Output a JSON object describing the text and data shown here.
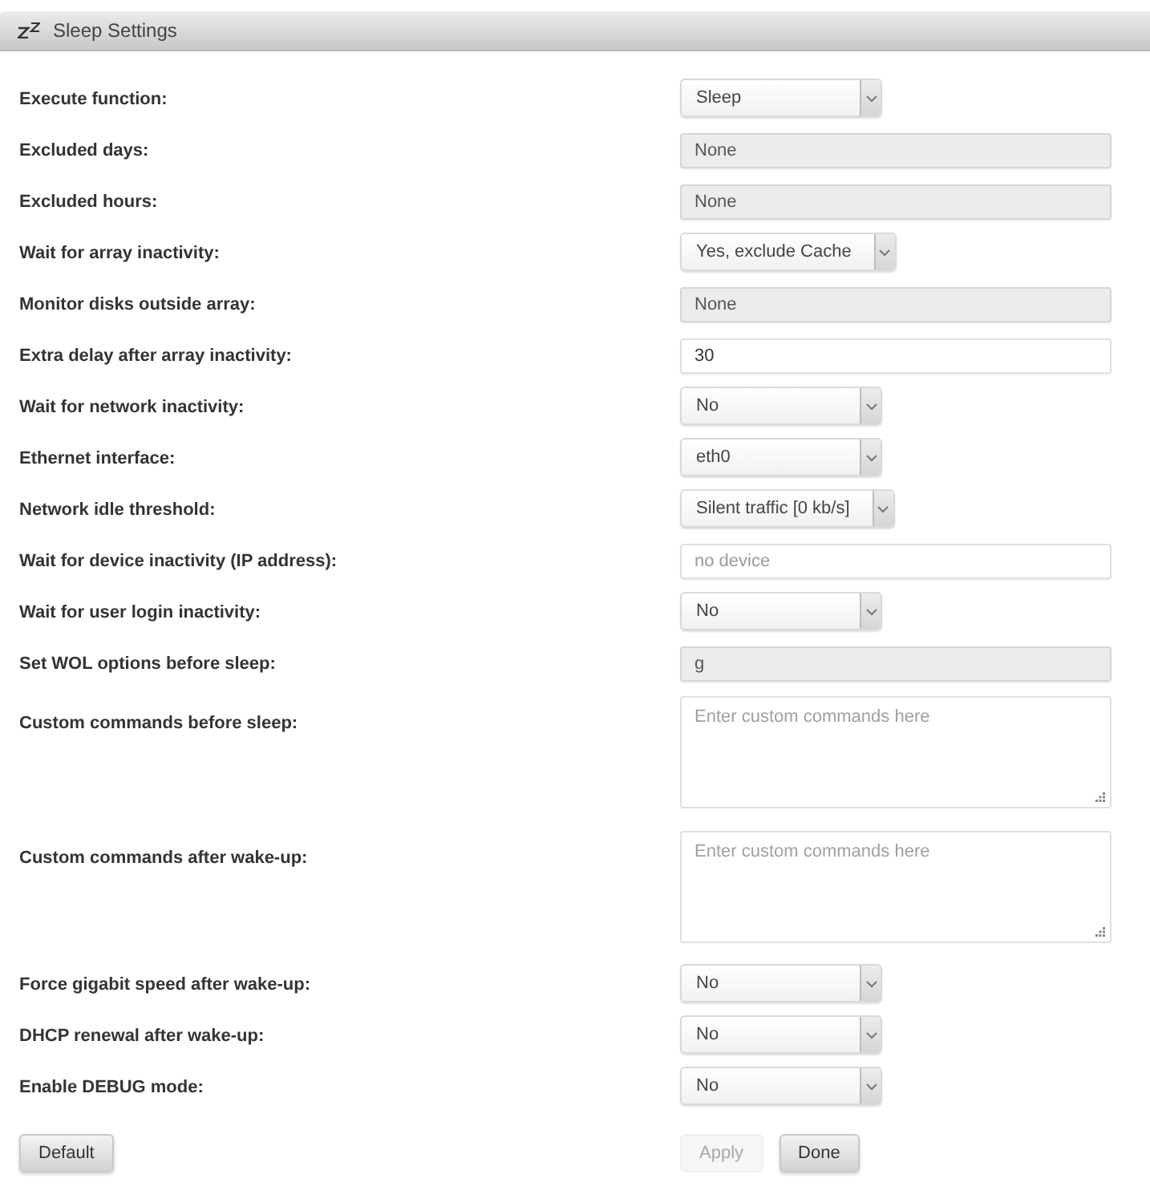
{
  "panel": {
    "title": "Sleep Settings"
  },
  "settings": [
    {
      "label": "Execute function:",
      "kind": "select",
      "value": "Sleep"
    },
    {
      "label": "Excluded days:",
      "kind": "text",
      "value": "None",
      "readonly": true
    },
    {
      "label": "Excluded hours:",
      "kind": "text",
      "value": "None",
      "readonly": true
    },
    {
      "label": "Wait for array inactivity:",
      "kind": "select",
      "value": "Yes, exclude Cache"
    },
    {
      "label": "Monitor disks outside array:",
      "kind": "text",
      "value": "None",
      "readonly": true
    },
    {
      "label": "Extra delay after array inactivity:",
      "kind": "text",
      "value": "30",
      "readonly": false
    },
    {
      "label": "Wait for network inactivity:",
      "kind": "select",
      "value": "No"
    },
    {
      "label": "Ethernet interface:",
      "kind": "select",
      "value": "eth0"
    },
    {
      "label": "Network idle threshold:",
      "kind": "select",
      "value": "Silent traffic [0 kb/s]"
    },
    {
      "label": "Wait for device inactivity (IP address):",
      "kind": "text",
      "placeholder": "no device",
      "readonly": false
    },
    {
      "label": "Wait for user login inactivity:",
      "kind": "select",
      "value": "No"
    },
    {
      "label": "Set WOL options before sleep:",
      "kind": "text",
      "value": "g",
      "readonly": true
    },
    {
      "label": "Custom commands before sleep:",
      "kind": "textarea",
      "placeholder": "Enter custom commands here"
    },
    {
      "label": "Custom commands after wake-up:",
      "kind": "textarea",
      "placeholder": "Enter custom commands here"
    },
    {
      "label": "Force gigabit speed after wake-up:",
      "kind": "select",
      "value": "No"
    },
    {
      "label": "DHCP renewal after wake-up:",
      "kind": "select",
      "value": "No"
    },
    {
      "label": "Enable DEBUG mode:",
      "kind": "select",
      "value": "No"
    }
  ],
  "buttons": {
    "left": [
      {
        "label": "Default",
        "disabled": false
      }
    ],
    "right": [
      {
        "label": "Apply",
        "disabled": true
      },
      {
        "label": "Done",
        "disabled": false
      }
    ]
  }
}
